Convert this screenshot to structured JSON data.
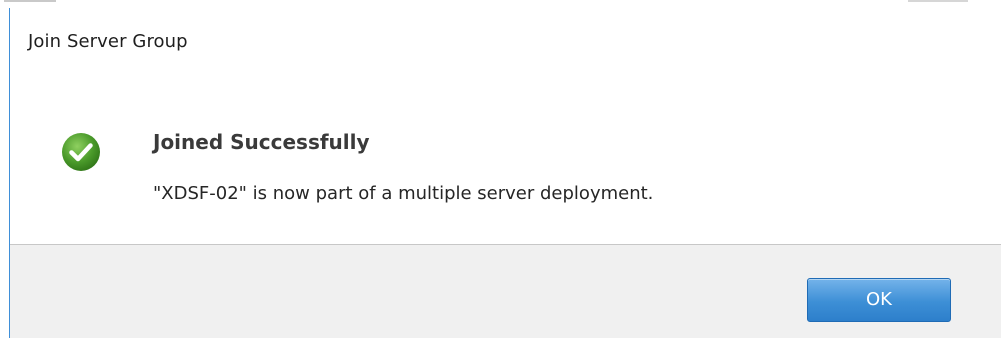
{
  "dialog": {
    "title": "Join Server Group",
    "heading": "Joined Successfully",
    "message": "\"XDSF-02\" is now part of a multiple server deployment.",
    "icon": "success-check-icon",
    "ok_label": "OK"
  },
  "colors": {
    "accent": "#3d8fd6",
    "success": "#4a9a2a",
    "footer_bg": "#f0f0f0"
  }
}
